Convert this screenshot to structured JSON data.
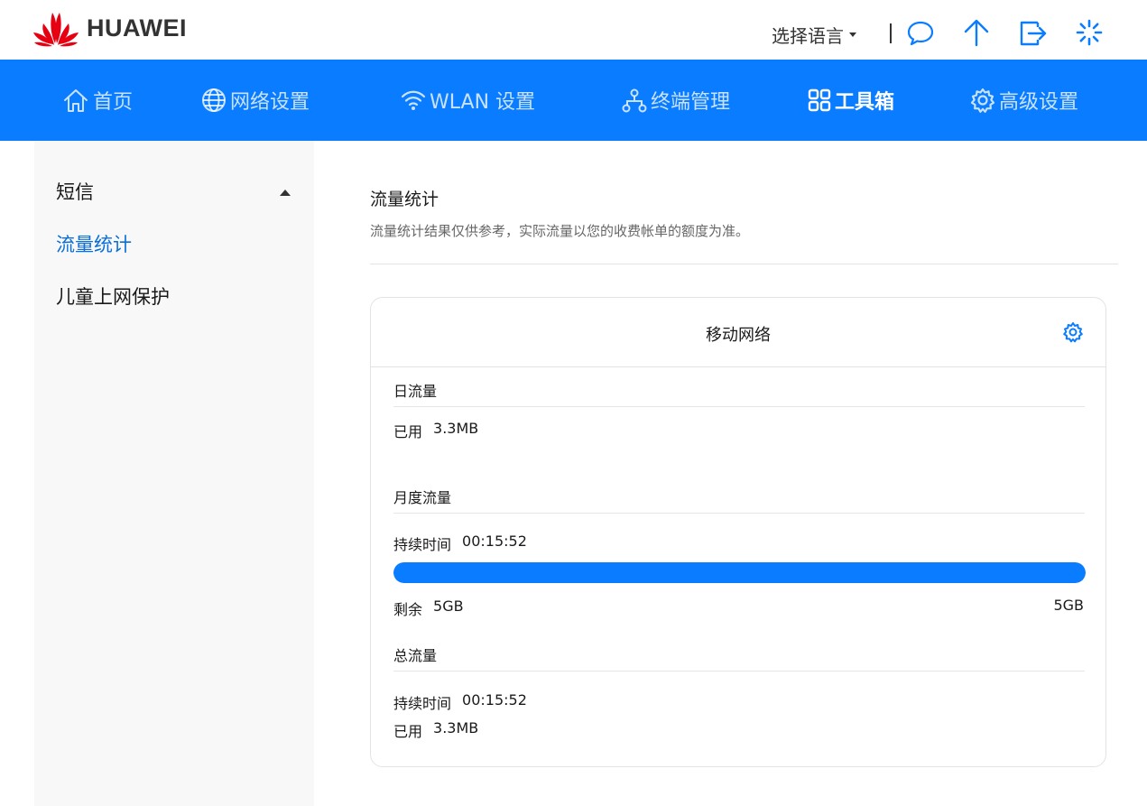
{
  "header": {
    "brand": "HUAWEI",
    "language_label": "选择语言",
    "icons": [
      "message-icon",
      "upload-icon",
      "logout-icon",
      "loading-icon"
    ],
    "accent_color": "#0a7cff",
    "logo_color": "#e60012"
  },
  "nav": {
    "items": [
      {
        "label": "首页",
        "icon": "home-icon"
      },
      {
        "label": "网络设置",
        "icon": "globe-icon"
      },
      {
        "label": "WLAN 设置",
        "icon": "wifi-icon"
      },
      {
        "label": "终端管理",
        "icon": "devices-icon"
      },
      {
        "label": "工具箱",
        "icon": "toolbox-icon",
        "active": true
      },
      {
        "label": "高级设置",
        "icon": "gear-icon"
      }
    ]
  },
  "sidebar": {
    "items": [
      {
        "label": "短信",
        "expandable": true
      },
      {
        "label": "流量统计",
        "active": true
      },
      {
        "label": "儿童上网保护"
      }
    ]
  },
  "main": {
    "title": "流量统计",
    "description": "流量统计结果仅供参考，实际流量以您的收费帐单的额度为准。",
    "card": {
      "title": "移动网络",
      "daily": {
        "title": "日流量",
        "used_label": "已用",
        "used_value": "3.3MB"
      },
      "monthly": {
        "title": "月度流量",
        "duration_label": "持续时间",
        "duration_value": "00:15:52",
        "remaining_fraction": 1.0,
        "remaining_label": "剩余",
        "remaining_value": "5GB",
        "total_value": "5GB"
      },
      "total": {
        "title": "总流量",
        "duration_label": "持续时间",
        "duration_value": "00:15:52",
        "used_label": "已用",
        "used_value": "3.3MB"
      }
    }
  }
}
